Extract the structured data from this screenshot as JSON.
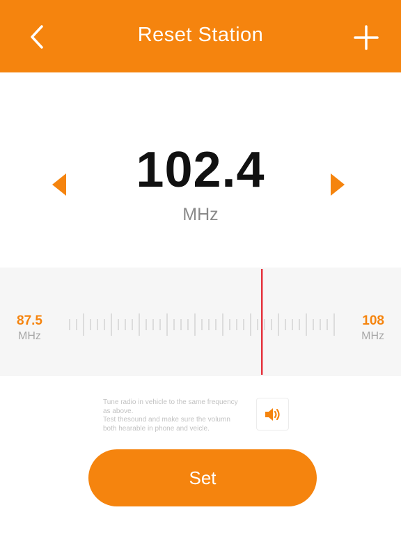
{
  "header": {
    "title": "Reset Station",
    "back_icon": "chevron-left-icon",
    "add_icon": "plus-icon",
    "background_color": "#f5840e"
  },
  "frequency": {
    "value": "102.4",
    "unit": "MHz"
  },
  "tuner": {
    "min_value": "87.5",
    "min_unit": "MHz",
    "max_value": "108",
    "max_unit": "MHz",
    "indicator_color": "#e5323c"
  },
  "hint": {
    "line1": "Tune radio in vehicle to the same frequency",
    "line2": "as above.",
    "line3": "Test thesound and make sure the volumn",
    "line4": "both hearable in phone and veicle."
  },
  "speaker_icon": "speaker-icon",
  "set_button": {
    "label": "Set"
  },
  "colors": {
    "accent": "#f5840e",
    "needle": "#e5323c"
  }
}
